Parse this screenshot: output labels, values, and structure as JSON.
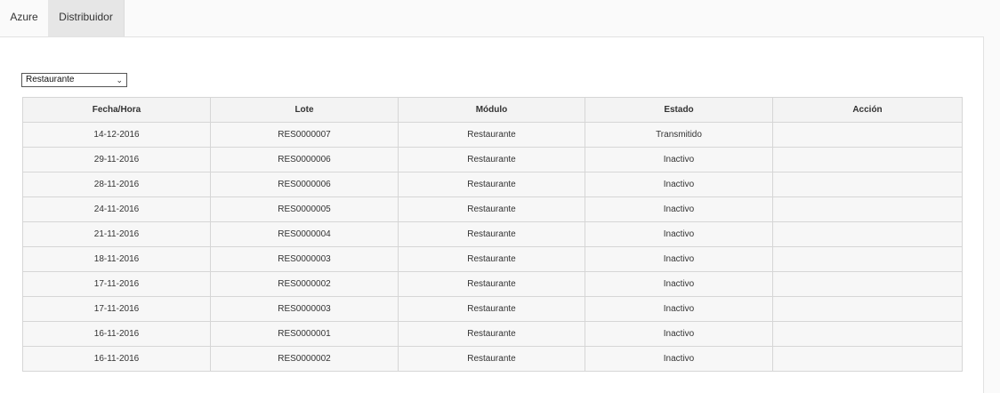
{
  "tabs": [
    {
      "label": "Azure"
    },
    {
      "label": "Distribuidor"
    }
  ],
  "filter": {
    "selected": "Restaurante"
  },
  "table": {
    "headers": [
      "Fecha/Hora",
      "Lote",
      "Módulo",
      "Estado",
      "Acción"
    ],
    "rows": [
      [
        "14-12-2016",
        "RES0000007",
        "Restaurante",
        "Transmitido",
        ""
      ],
      [
        "29-11-2016",
        "RES0000006",
        "Restaurante",
        "Inactivo",
        ""
      ],
      [
        "28-11-2016",
        "RES0000006",
        "Restaurante",
        "Inactivo",
        ""
      ],
      [
        "24-11-2016",
        "RES0000005",
        "Restaurante",
        "Inactivo",
        ""
      ],
      [
        "21-11-2016",
        "RES0000004",
        "Restaurante",
        "Inactivo",
        ""
      ],
      [
        "18-11-2016",
        "RES0000003",
        "Restaurante",
        "Inactivo",
        ""
      ],
      [
        "17-11-2016",
        "RES0000002",
        "Restaurante",
        "Inactivo",
        ""
      ],
      [
        "17-11-2016",
        "RES0000003",
        "Restaurante",
        "Inactivo",
        ""
      ],
      [
        "16-11-2016",
        "RES0000001",
        "Restaurante",
        "Inactivo",
        ""
      ],
      [
        "16-11-2016",
        "RES0000002",
        "Restaurante",
        "Inactivo",
        ""
      ]
    ]
  },
  "icons": {
    "dropdown": "chevron-down-icon"
  }
}
